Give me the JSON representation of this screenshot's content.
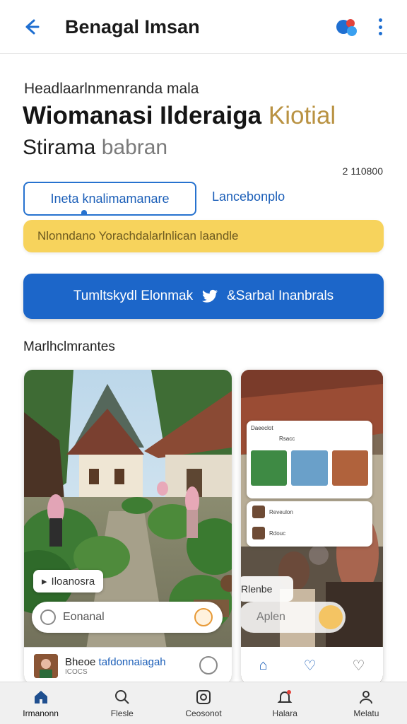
{
  "app": {
    "title": "Benagal Imsan"
  },
  "header": {
    "eyebrow": "Headlaarlnmenranda mala",
    "title_main": "Wiomanasi Ilderaiga",
    "title_accent": "Kiotial",
    "subtitle_main": "Stirama",
    "subtitle_light": "babran",
    "count": "2 110800"
  },
  "tabs": [
    {
      "label": "Ineta knalimamanare",
      "active": true
    },
    {
      "label": "Lancebonplo",
      "active": false
    }
  ],
  "notice": {
    "text": "Nlonndano Yorachdalarlnlican laandle"
  },
  "cta": {
    "label_left": "Tumltskydl Elonmak",
    "label_right": "&Sarbal Inanbrals",
    "icon": "bird-icon"
  },
  "section": {
    "title": "Marlhclmrantes"
  },
  "card1": {
    "pill": "Iloanosra",
    "field_placeholder": "Eonanal",
    "bottom_title_plain": "Bheoe",
    "bottom_title_blue": "tafdonnaiagah",
    "bottom_sub": "ICOCS"
  },
  "card2": {
    "inner_title": "Daeeclot",
    "inner_sub": "Rsacc",
    "list_1": "Reveulon",
    "list_2": "Rdouc",
    "pill": "Rlenbe",
    "field_placeholder": "Aplen"
  },
  "bottom_nav": [
    {
      "label": "Irmanonn",
      "icon": "home-icon",
      "active": true
    },
    {
      "label": "Flesle",
      "icon": "search-icon",
      "active": false
    },
    {
      "label": "Ceosonot",
      "icon": "camera-icon",
      "active": false
    },
    {
      "label": "Halara",
      "icon": "bell-icon",
      "active": false
    },
    {
      "label": "Melatu",
      "icon": "person-icon",
      "active": false
    }
  ],
  "colors": {
    "accent": "#1c66c9",
    "notice": "#f7d35c",
    "gold": "#b99242"
  }
}
